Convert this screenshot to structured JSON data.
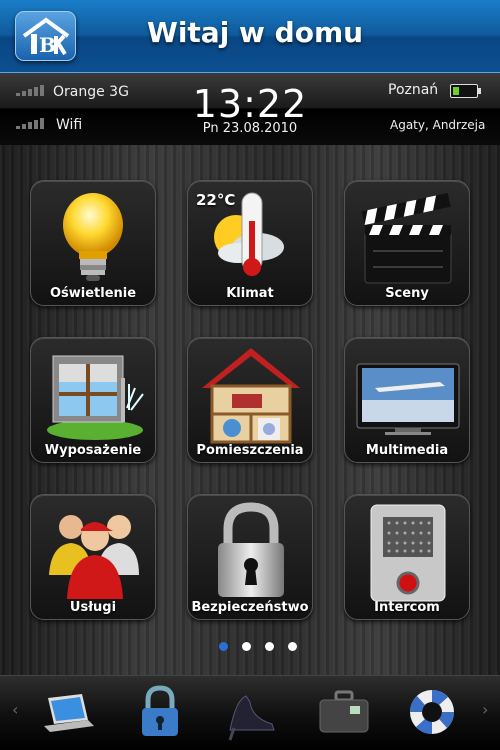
{
  "header": {
    "title": "Witaj w domu",
    "logo_icon": "house-logo-icon"
  },
  "status": {
    "carrier": "Orange 3G",
    "network": "Wifi",
    "time": "13:22",
    "date": "Pn 23.08.2010",
    "city": "Poznań",
    "street": "Agaty, Andrzeja",
    "battery_level": 0.25
  },
  "tiles": [
    {
      "label": "Oświetlenie",
      "icon": "light-bulb-icon"
    },
    {
      "label": "Klimat",
      "icon": "thermometer-icon",
      "temperature": "22°C"
    },
    {
      "label": "Sceny",
      "icon": "clapperboard-icon"
    },
    {
      "label": "Wyposażenie",
      "icon": "window-blind-icon"
    },
    {
      "label": "Pomieszczenia",
      "icon": "house-rooms-icon"
    },
    {
      "label": "Multimedia",
      "icon": "tv-icon"
    },
    {
      "label": "Usługi",
      "icon": "service-people-icon"
    },
    {
      "label": "Bezpieczeństwo",
      "icon": "padlock-icon"
    },
    {
      "label": "Intercom",
      "icon": "intercom-icon"
    }
  ],
  "pager": {
    "pages": 4,
    "current": 1
  },
  "dock": [
    "laptop-icon",
    "padlock-icon",
    "high-heel-icon",
    "suitcase-icon",
    "lifebuoy-icon"
  ],
  "colors": {
    "header": "#0f5a9c",
    "active_dot": "#2a6fd4",
    "battery": "#6cd02a"
  }
}
